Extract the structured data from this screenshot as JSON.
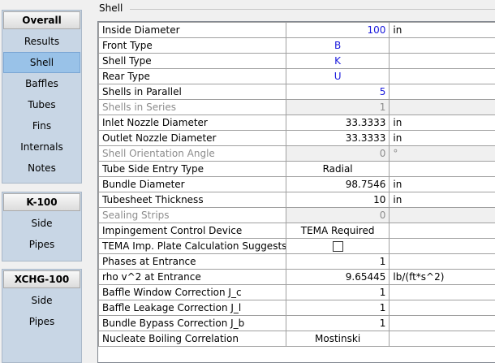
{
  "nav": {
    "groups": [
      {
        "header": "Overall",
        "items": [
          "Results",
          "Shell",
          "Baffles",
          "Tubes",
          "Fins",
          "Internals",
          "Notes"
        ]
      },
      {
        "header": "K-100",
        "items": [
          "Side",
          "Pipes"
        ]
      },
      {
        "header": "XCHG-100",
        "items": [
          "Side",
          "Pipes"
        ]
      }
    ]
  },
  "section_title": "Shell",
  "rows": [
    {
      "label": "Inside Diameter",
      "value": "100",
      "unit": "in"
    },
    {
      "label": "Front Type",
      "value": "B",
      "unit": ""
    },
    {
      "label": "Shell Type",
      "value": "K",
      "unit": ""
    },
    {
      "label": "Rear Type",
      "value": "U",
      "unit": ""
    },
    {
      "label": "Shells in Parallel",
      "value": "5",
      "unit": ""
    },
    {
      "label": "Shells in Series",
      "value": "1",
      "unit": ""
    },
    {
      "label": "Inlet Nozzle Diameter",
      "value": "33.3333",
      "unit": "in"
    },
    {
      "label": "Outlet Nozzle Diameter",
      "value": "33.3333",
      "unit": "in"
    },
    {
      "label": "Shell Orientation Angle",
      "value": "0",
      "unit": "°"
    },
    {
      "label": "Tube Side Entry Type",
      "value": "Radial",
      "unit": ""
    },
    {
      "label": "Bundle Diameter",
      "value": "98.7546",
      "unit": "in"
    },
    {
      "label": "Tubesheet Thickness",
      "value": "10",
      "unit": "in"
    },
    {
      "label": "Sealing Strips",
      "value": "0",
      "unit": ""
    },
    {
      "label": "Impingement Control Device",
      "value": "TEMA Required",
      "unit": ""
    },
    {
      "label": "TEMA Imp. Plate Calculation Suggests",
      "value": "",
      "unit": ""
    },
    {
      "label": "Phases at Entrance",
      "value": "1",
      "unit": ""
    },
    {
      "label": "rho v^2 at Entrance",
      "value": "9.65445",
      "unit": "lb/(ft*s^2)"
    },
    {
      "label": "Baffle Window Correction J_c",
      "value": "1",
      "unit": ""
    },
    {
      "label": "Baffle Leakage Correction J_l",
      "value": "1",
      "unit": ""
    },
    {
      "label": "Bundle Bypass Correction J_b",
      "value": "1",
      "unit": ""
    },
    {
      "label": "Nucleate Boiling Correlation",
      "value": "Mostinski",
      "unit": ""
    }
  ]
}
